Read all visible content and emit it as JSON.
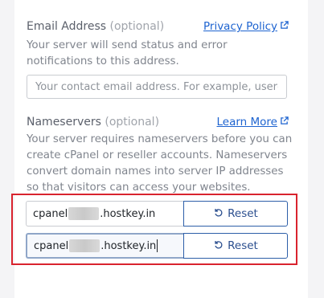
{
  "email": {
    "label": "Email Address",
    "optional": "(optional)",
    "link_label": "Privacy Policy",
    "description": "Your server will send status and error notifications to this address.",
    "placeholder": "Your contact email address. For example, user@ex",
    "value": ""
  },
  "nameservers": {
    "label": "Nameservers",
    "optional": "(optional)",
    "link_label": "Learn More",
    "description": "Your server requires nameservers before you can create cPanel or reseller accounts. Nameservers convert domain names into server IP addresses so that visitors can access your websites.",
    "entries": [
      {
        "prefix": "cpanel",
        "suffix": ".hostkey.in",
        "reset_label": "Reset"
      },
      {
        "prefix": "cpanel",
        "suffix": ".hostkey.in",
        "reset_label": "Reset"
      }
    ]
  },
  "colors": {
    "link": "#1d63d0",
    "highlight_border": "#d9232e",
    "button_border": "#2d5fa8"
  },
  "icons": {
    "external_link": "external-link-icon",
    "reset": "undo-icon"
  }
}
